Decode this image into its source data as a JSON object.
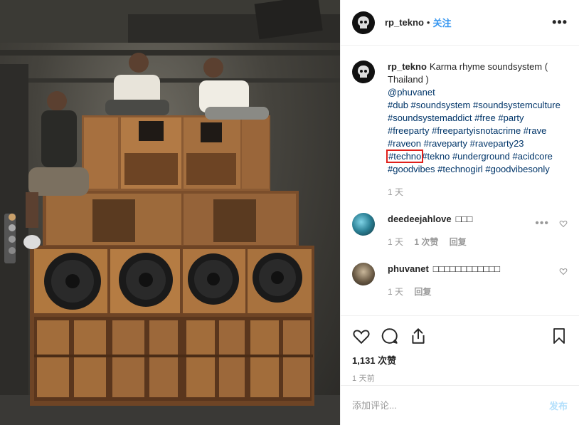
{
  "header": {
    "username": "rp_tekno",
    "separator": "•",
    "follow_label": "关注",
    "more_icon": "ellipsis-icon",
    "more_label": "•••"
  },
  "caption": {
    "username": "rp_tekno",
    "text": "Karma rhyme soundsystem ( Thailand )",
    "mention": "@phuvanet",
    "hashtags": [
      "#dub",
      "#soundsystem",
      "#soundsystemculture",
      "#soundsystemaddict",
      "#free",
      "#party",
      "#freeparty",
      "#freepartyisnotacrime",
      "#rave",
      "#raveon",
      "#raveparty",
      "#raveparty23",
      "#techno",
      "#tekno",
      "#underground",
      "#acidcore",
      "#goodvibes",
      "#technogirl",
      "#goodvibesonly"
    ],
    "highlighted_tag": "#techno",
    "highlight_color": "#e0201b",
    "time": "1 天"
  },
  "comments": [
    {
      "username": "deedeejahlove",
      "text": "□□□",
      "time": "1 天",
      "likes": "1 次赞",
      "reply": "回复",
      "more_label": "•••"
    },
    {
      "username": "phuvanet",
      "text": "□□□□□□□□□□□□",
      "time": "1 天",
      "likes": "",
      "reply": "回复"
    }
  ],
  "actions": {
    "like_icon": "heart-icon",
    "comment_icon": "comment-icon",
    "share_icon": "share-icon",
    "save_icon": "bookmark-icon",
    "likes_count": "1,131 次赞",
    "time_ago": "1 天前"
  },
  "add_comment": {
    "placeholder": "添加评论...",
    "post_label": "发布"
  },
  "colors": {
    "link": "#3897f0",
    "hashtag": "#003569",
    "muted": "#999999",
    "post_disabled": "#b2dffc"
  }
}
